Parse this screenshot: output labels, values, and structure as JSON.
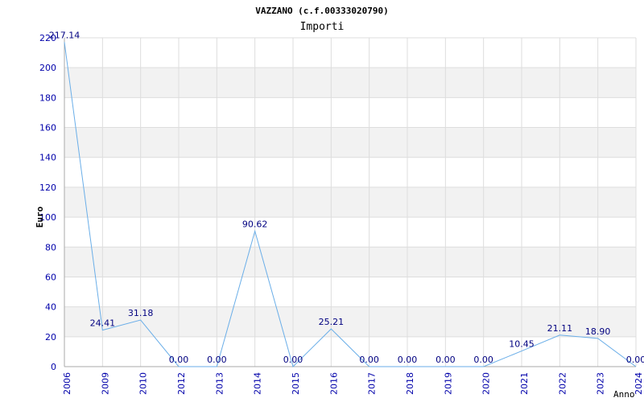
{
  "chart_data": {
    "type": "line",
    "title": "VAZZANO (c.f.00333020790)",
    "subtitle": "Importi",
    "xlabel": "Anno",
    "ylabel": "Euro",
    "ylim": [
      0,
      220
    ],
    "yticks": [
      0,
      20,
      40,
      60,
      80,
      100,
      120,
      140,
      160,
      180,
      200,
      220
    ],
    "categories": [
      "2006",
      "2009",
      "2010",
      "2012",
      "2013",
      "2014",
      "2015",
      "2016",
      "2017",
      "2018",
      "2019",
      "2020",
      "2021",
      "2022",
      "2023",
      "2024"
    ],
    "values": [
      217.14,
      24.41,
      31.18,
      0.0,
      0.0,
      90.62,
      0.0,
      25.21,
      0.0,
      0.0,
      0.0,
      0.0,
      10.45,
      21.11,
      18.9,
      0.0
    ],
    "value_labels": [
      "217.14",
      "24.41",
      "31.18",
      "0.00",
      "0.00",
      "90.62",
      "0.00",
      "25.21",
      "0.00",
      "0.00",
      "0.00",
      "0.00",
      "10.45",
      "21.11",
      "18.90",
      "0.00"
    ],
    "grid": true,
    "colors": {
      "line": "#6aaee8",
      "axis_text": "#0000aa",
      "value_label": "#000080",
      "title": "#000000",
      "band": "#f2f2f2",
      "grid": "#dddddd"
    }
  }
}
